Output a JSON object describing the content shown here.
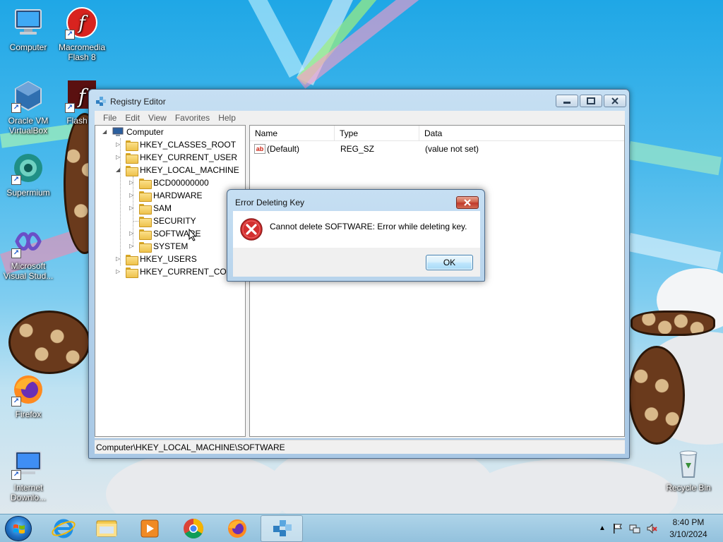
{
  "desktop": {
    "icons": [
      {
        "id": "computer",
        "label": "Computer"
      },
      {
        "id": "flash8",
        "label": "Macromedia Flash 8"
      },
      {
        "id": "virtualbox",
        "label": "Oracle VM VirtualBox"
      },
      {
        "id": "flashplayer",
        "label": "Flash Pl"
      },
      {
        "id": "supermium",
        "label": "Supermium"
      },
      {
        "id": "visualstudio",
        "label": "Microsoft Visual Stud..."
      },
      {
        "id": "firefox",
        "label": "Firefox"
      },
      {
        "id": "internet-download",
        "label": "Internet Downlo..."
      },
      {
        "id": "recycle-bin",
        "label": "Recycle Bin"
      }
    ]
  },
  "window": {
    "title": "Registry Editor",
    "menu": [
      "File",
      "Edit",
      "View",
      "Favorites",
      "Help"
    ],
    "tree": {
      "root": "Computer",
      "items": [
        {
          "label": "HKEY_CLASSES_ROOT"
        },
        {
          "label": "HKEY_CURRENT_USER"
        },
        {
          "label": "HKEY_LOCAL_MACHINE"
        },
        {
          "label": "BCD00000000"
        },
        {
          "label": "HARDWARE"
        },
        {
          "label": "SAM"
        },
        {
          "label": "SECURITY"
        },
        {
          "label": "SOFTWARE"
        },
        {
          "label": "SYSTEM"
        },
        {
          "label": "HKEY_USERS"
        },
        {
          "label": "HKEY_CURRENT_CONF"
        }
      ]
    },
    "list": {
      "columns": [
        "Name",
        "Type",
        "Data"
      ],
      "rows": [
        {
          "name": "(Default)",
          "type": "REG_SZ",
          "data": "(value not set)"
        }
      ]
    },
    "status": "Computer\\HKEY_LOCAL_MACHINE\\SOFTWARE"
  },
  "dialog": {
    "title": "Error Deleting Key",
    "message": "Cannot delete SOFTWARE:  Error while deleting key.",
    "ok_label": "OK"
  },
  "taskbar": {
    "pinned": [
      "internet-explorer-icon",
      "file-explorer-icon",
      "media-player-icon",
      "chrome-icon",
      "firefox-icon",
      "regedit-icon"
    ],
    "time": "8:40 PM",
    "date": "3/10/2024"
  },
  "colors": {
    "sky": "#1fa7e6",
    "window_frame": "#b5d3ec",
    "close_red": "#c0392b",
    "error_red": "#d32f2f"
  }
}
